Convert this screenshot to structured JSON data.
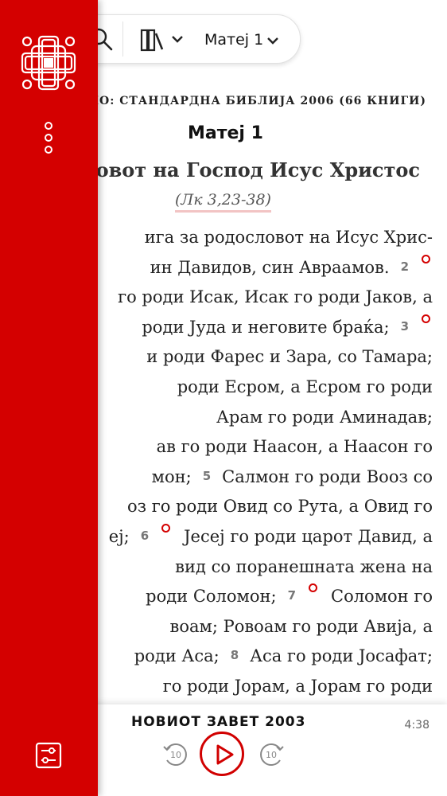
{
  "topbar": {
    "chapter_label": "Матеј 1"
  },
  "reader": {
    "version_line": "МО: СТАНДАРДНА БИБЛИЈА 2006 (66 КНИГИ)",
    "chapter_title": "Матеј 1",
    "section_heading": "ловот на Господ Исус Христос",
    "cross_reference": "(Лк 3,23-38)",
    "lines": [
      {
        "text": "ига за родословот на Исус Хрис-",
        "vnum": "",
        "marker": false
      },
      {
        "text": "ин Давидов, син Авраамов.",
        "vnum": "2",
        "marker": true
      },
      {
        "text": "го роди Исак, Исак го роди Јаков, а",
        "vnum": "",
        "marker": false
      },
      {
        "text": "роди Јуда и неговите браќа;",
        "vnum": "3",
        "marker": true
      },
      {
        "text": "и роди Фарес и Зара, со Тамара;",
        "vnum": "",
        "marker": false
      },
      {
        "text": "роди Есром, а Есром го роди",
        "vnum": "",
        "marker": false
      },
      {
        "text": "Арам го роди Аминадав;",
        "vnum": "",
        "marker": false
      },
      {
        "text": "ав го роди Наасон, а Наасон го",
        "vnum": "",
        "marker": false
      },
      {
        "text": "мон;",
        "vnum": "5",
        "rest": "Салмон го роди Вооз со",
        "marker": false
      },
      {
        "text": "оз го роди Овид со Рута, а Овид го",
        "vnum": "",
        "marker": false
      },
      {
        "text": "еј;",
        "vnum": "6",
        "rest": "Јесеј го роди царот Давид, а",
        "marker": true
      },
      {
        "text": "вид со поранешната жена на",
        "vnum": "",
        "marker": false
      },
      {
        "text": "роди Соломон;",
        "vnum": "7",
        "rest": "Соломон го",
        "marker": true
      },
      {
        "text": "воам; Ровоам го роди Авија, а",
        "vnum": "",
        "marker": false
      },
      {
        "text": "роди Аса;",
        "vnum": "8",
        "rest": "Аса го роди Јосафат;",
        "marker": false
      },
      {
        "text": "го роди Јорам, а Јорам го роди",
        "vnum": "",
        "marker": false
      }
    ]
  },
  "audio": {
    "title": "НОВИОТ ЗАВЕТ 2003",
    "time": "4:38",
    "rewind_label": "10",
    "forward_label": "10"
  },
  "icons": {
    "search": "search-icon",
    "version": "library-books-icon",
    "chapter_dropdown": "chevron-down-icon",
    "logo": "cross-knot-logo",
    "more": "more-vertical-icon",
    "settings": "sliders-icon",
    "play": "play-icon",
    "rewind": "rewind-10-icon",
    "forward": "forward-10-icon"
  },
  "colors": {
    "brand_red": "#d40000",
    "marker_red": "#d40000",
    "xref_underline": "#f2c4c4"
  }
}
